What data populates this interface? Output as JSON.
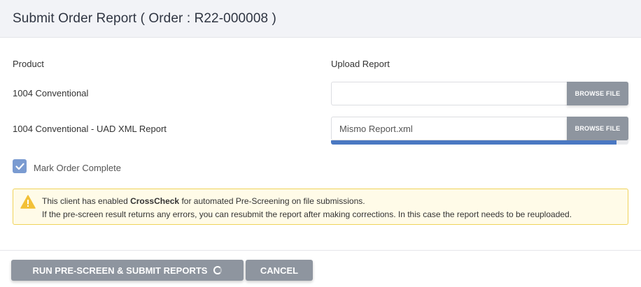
{
  "header": {
    "title": "Submit Order Report ( Order : R22-000008 )"
  },
  "columns": {
    "product": "Product",
    "upload": "Upload Report"
  },
  "rows": [
    {
      "product": "1004 Conventional",
      "file_value": "",
      "browse_label": "BROWSE FILE"
    },
    {
      "product": "1004 Conventional - UAD XML Report",
      "file_value": "Mismo Report.xml",
      "browse_label": "BROWSE FILE",
      "upload_progress_percent": 96
    }
  ],
  "mark_complete": {
    "label": "Mark Order Complete",
    "checked": true
  },
  "alert": {
    "line1_prefix": "This client has enabled ",
    "line1_bold": "CrossCheck",
    "line1_suffix": " for automated Pre-Screening on file submissions.",
    "line2": "If the pre-screen result returns any errors, you can resubmit the report after making corrections. In this case the report needs to be reuploaded."
  },
  "actions": {
    "submit_label": "RUN PRE-SCREEN & SUBMIT REPORTS",
    "cancel_label": "CANCEL"
  },
  "colors": {
    "button_gray": "#8e959f",
    "progress_blue": "#4a78c2",
    "checkbox_blue": "#7a9bd1",
    "alert_bg": "#fffbe8",
    "alert_border": "#f0d35a",
    "warning_icon": "#f2c037"
  },
  "icons": {
    "warning": "warning-triangle-icon",
    "check": "check-icon",
    "spinner": "spinner-icon"
  }
}
